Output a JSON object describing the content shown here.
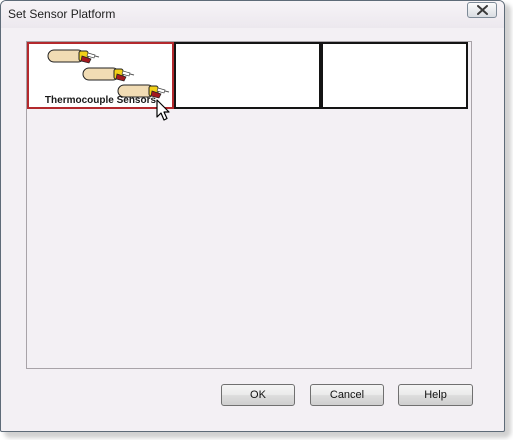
{
  "window": {
    "title": "Set Sensor Platform"
  },
  "platforms": [
    {
      "label": "Thermocouple Sensors",
      "icon": "thermocouple-sensors-icon",
      "selected": true
    },
    {
      "label": "",
      "selected": false
    },
    {
      "label": "",
      "selected": false
    }
  ],
  "buttons": {
    "ok_label": "OK",
    "cancel_label": "Cancel",
    "help_label": "Help"
  },
  "colors": {
    "selection_border": "#b3292d",
    "dialog_background": "#f3f0f4"
  }
}
